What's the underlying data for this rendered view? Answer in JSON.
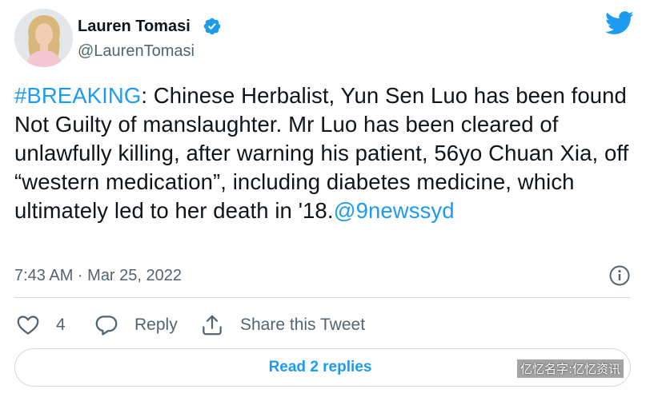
{
  "author": {
    "name": "Lauren Tomasi",
    "handle": "@LaurenTomasi",
    "verified": true
  },
  "tweet": {
    "hashtag": "#BREAKING",
    "body": ": Chinese Herbalist, Yun Sen Luo has been found Not Guilty of manslaughter. Mr Luo has been cleared of unlawfully killing, after warning his patient, 56yo Chuan Xia, off “western medication”, including diabetes medicine, which ultimately led to her death in '18.",
    "mention": "@9newssyd",
    "timestamp": "7:43 AM · Mar 25, 2022"
  },
  "actions": {
    "like_count": "4",
    "reply_label": "Reply",
    "share_label": "Share this Tweet"
  },
  "replies_button": "Read 2 replies",
  "watermark": "亿忆名字:亿忆资讯",
  "colors": {
    "link": "#1d9bf0",
    "text": "#0f1419",
    "secondary": "#536471",
    "border": "#cfd9de"
  },
  "icons": [
    "verified-badge-icon",
    "twitter-bird-icon",
    "info-icon",
    "heart-icon",
    "reply-bubble-icon",
    "share-icon"
  ]
}
